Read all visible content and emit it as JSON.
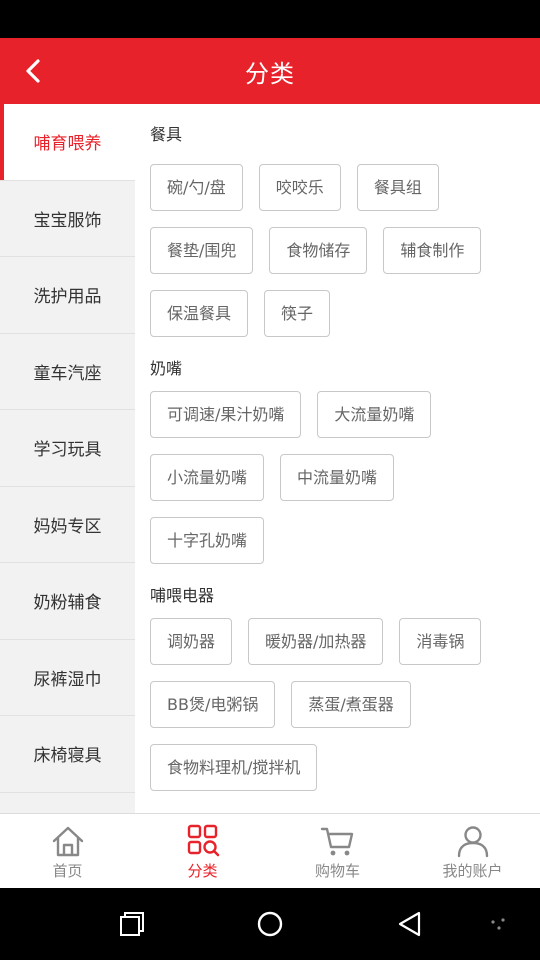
{
  "header": {
    "title": "分类",
    "back_icon": "chevron-left-icon"
  },
  "sidebar": {
    "items": [
      {
        "label": "哺育喂养",
        "active": true
      },
      {
        "label": "宝宝服饰"
      },
      {
        "label": "洗护用品"
      },
      {
        "label": "童车汽座"
      },
      {
        "label": "学习玩具"
      },
      {
        "label": "妈妈专区"
      },
      {
        "label": "奶粉辅食"
      },
      {
        "label": "尿裤湿巾"
      },
      {
        "label": "床椅寝具"
      }
    ]
  },
  "content": {
    "sections": [
      {
        "title": "餐具",
        "tags": [
          "碗/勺/盘",
          "咬咬乐",
          "餐具组",
          "餐垫/围兜",
          "食物储存",
          "辅食制作",
          "保温餐具",
          "筷子"
        ]
      },
      {
        "title": "奶嘴",
        "tags": [
          "可调速/果汁奶嘴",
          "大流量奶嘴",
          "小流量奶嘴",
          "中流量奶嘴",
          "十字孔奶嘴"
        ]
      },
      {
        "title": "哺喂电器",
        "tags": [
          "调奶器",
          "暖奶器/加热器",
          "消毒锅",
          "BB煲/电粥锅",
          "蒸蛋/煮蛋器",
          "食物料理机/搅拌机"
        ]
      }
    ]
  },
  "tabbar": {
    "tabs": [
      {
        "label": "首页",
        "icon": "home-icon"
      },
      {
        "label": "分类",
        "icon": "category-icon",
        "active": true
      },
      {
        "label": "购物车",
        "icon": "cart-icon"
      },
      {
        "label": "我的账户",
        "icon": "user-icon"
      }
    ]
  },
  "colors": {
    "accent": "#e8222a",
    "sidebar_bg": "#f2f2f2",
    "tag_border": "#c8c8c8"
  }
}
